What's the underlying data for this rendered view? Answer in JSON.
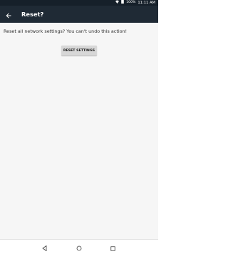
{
  "status_bar": {
    "battery": "100%",
    "time": "11:11 AM",
    "icons": [
      "wifi-icon",
      "battery-icon"
    ]
  },
  "toolbar": {
    "title": "Reset?",
    "back_icon": "arrow-back-icon"
  },
  "main": {
    "message": "Reset all network settings? You can't undo this action!",
    "reset_button_label": "RESET SETTINGS"
  },
  "nav_bar": {
    "icons": [
      "back-triangle-icon",
      "home-circle-icon",
      "recents-square-icon"
    ]
  },
  "colors": {
    "status_bar_bg": "#16202a",
    "toolbar_bg": "#1f2a35",
    "content_bg": "#f6f6f6",
    "button_bg": "#d7d7d7"
  }
}
